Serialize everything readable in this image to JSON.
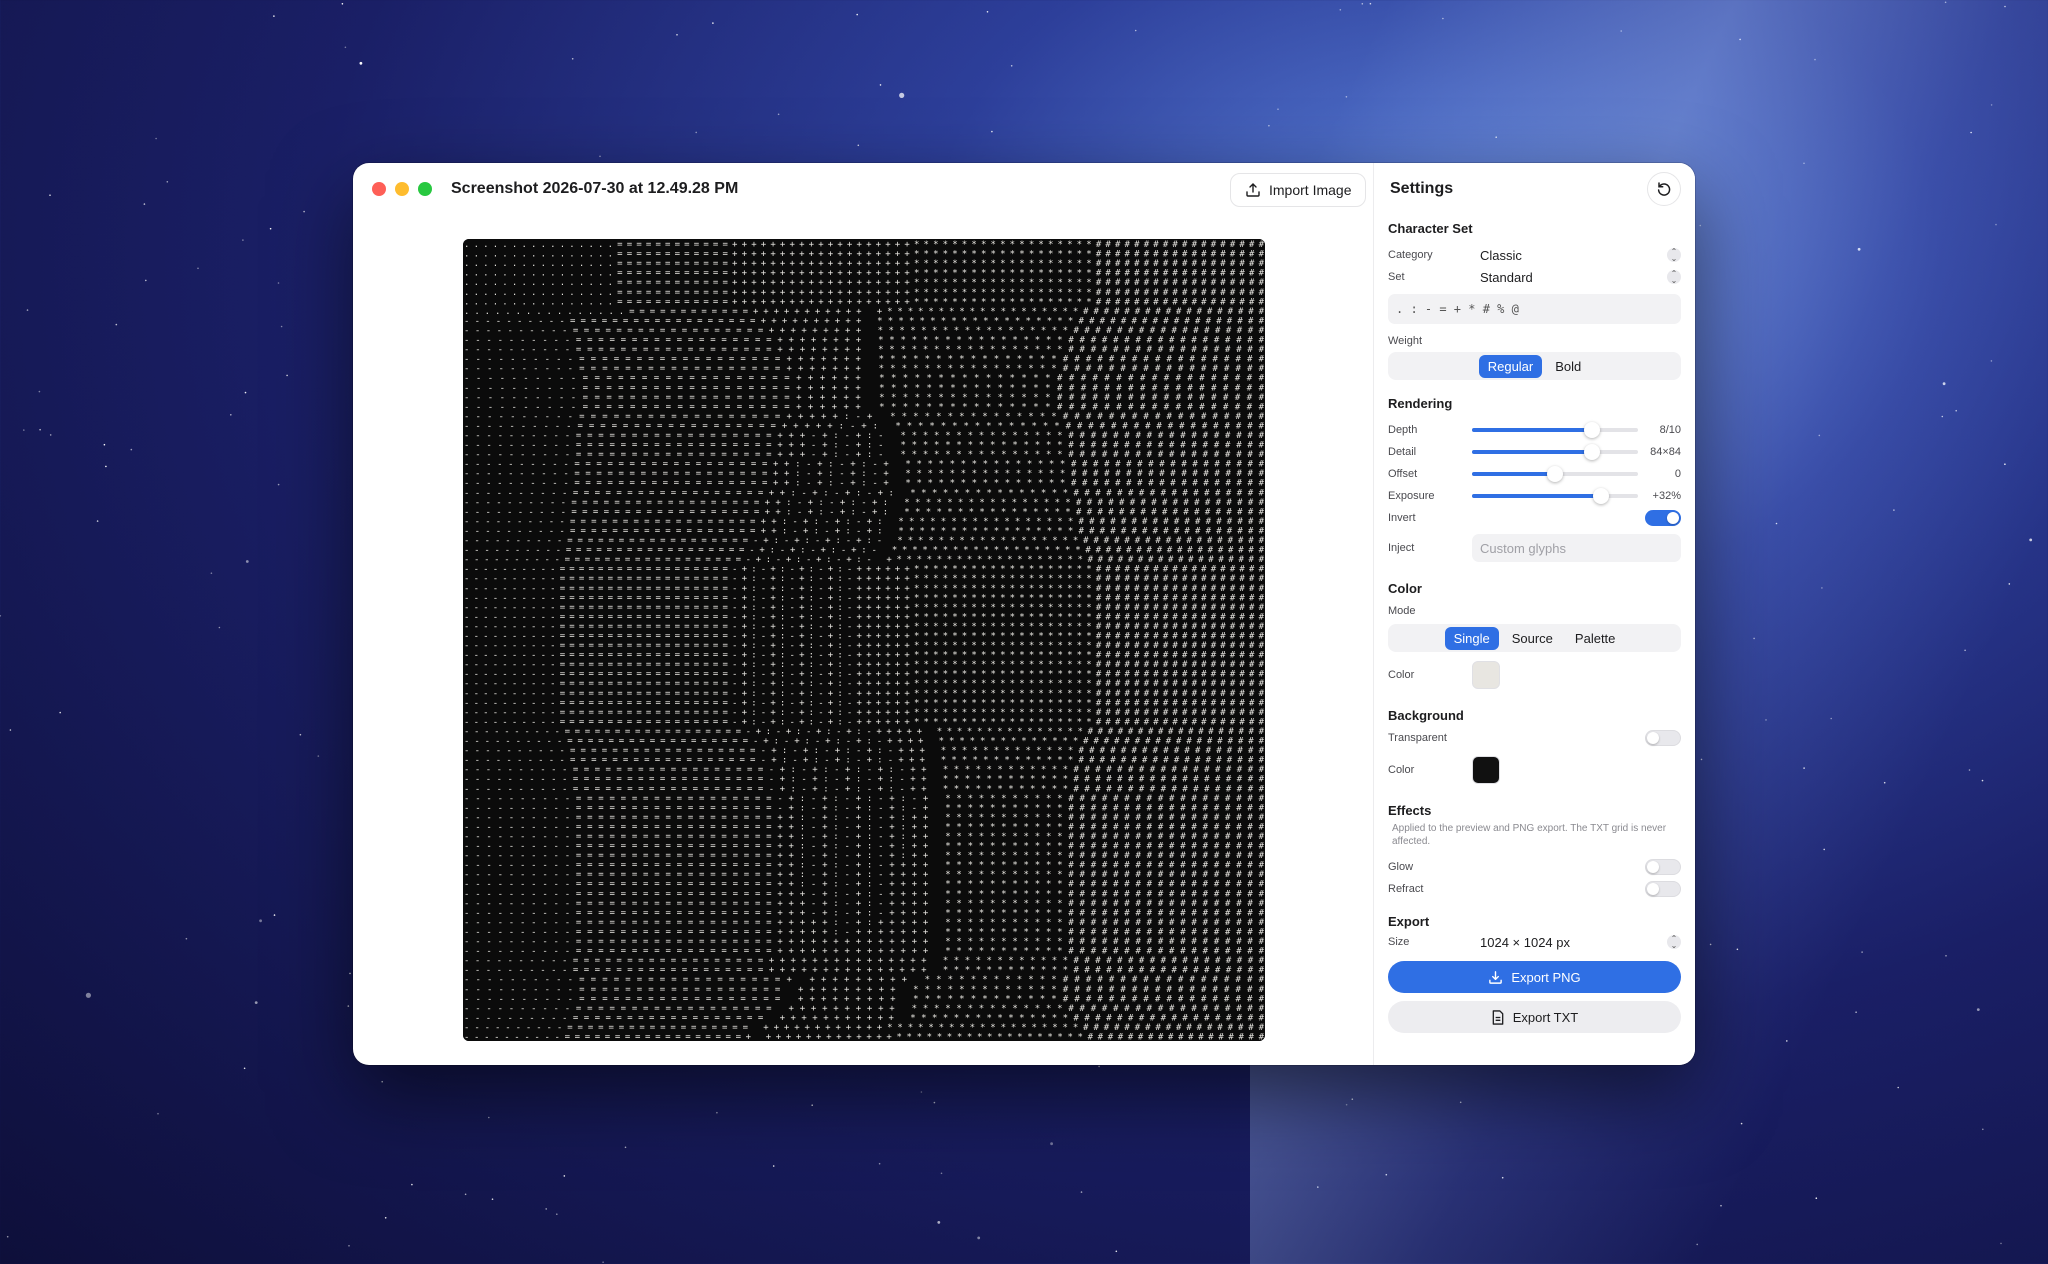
{
  "window": {
    "title": "Screenshot 2026-07-30 at 12.49.28 PM",
    "import_label": "Import Image"
  },
  "settings": {
    "title": "Settings",
    "character_set": {
      "heading": "Character Set",
      "category_label": "Category",
      "category_value": "Classic",
      "set_label": "Set",
      "set_value": "Standard",
      "chars": ". : - = + * # % @",
      "weight_label": "Weight",
      "weight_options": [
        "Regular",
        "Bold"
      ],
      "weight_selected": "Regular"
    },
    "rendering": {
      "heading": "Rendering",
      "depth": {
        "label": "Depth",
        "value": "8/10",
        "fraction": 0.72
      },
      "detail": {
        "label": "Detail",
        "value": "84×84",
        "fraction": 0.72
      },
      "offset": {
        "label": "Offset",
        "value": "0",
        "fraction": 0.5
      },
      "exposure": {
        "label": "Exposure",
        "value": "+32%",
        "fraction": 0.78
      },
      "invert_label": "Invert",
      "invert_on": true,
      "inject_label": "Inject",
      "inject_placeholder": "Custom glyphs"
    },
    "color": {
      "heading": "Color",
      "mode_label": "Mode",
      "mode_options": [
        "Single",
        "Source",
        "Palette"
      ],
      "mode_selected": "Single",
      "color_label": "Color",
      "color_value": "#e8e6e1"
    },
    "background": {
      "heading": "Background",
      "transparent_label": "Transparent",
      "transparent_on": false,
      "color_label": "Color",
      "color_value": "#111111"
    },
    "effects": {
      "heading": "Effects",
      "note": "Applied to the preview and PNG export. The TXT grid is never affected.",
      "glow_label": "Glow",
      "glow_on": false,
      "refract_label": "Refract",
      "refract_on": false
    },
    "export": {
      "heading": "Export",
      "size_label": "Size",
      "size_value": "1024 × 1024 px",
      "png_label": "Export PNG",
      "txt_label": "Export TXT"
    }
  },
  "colors": {
    "accent": "#2f6fe4",
    "ascii_fg": "#e8e6e1",
    "ascii_bg": "#0b0b0b"
  }
}
